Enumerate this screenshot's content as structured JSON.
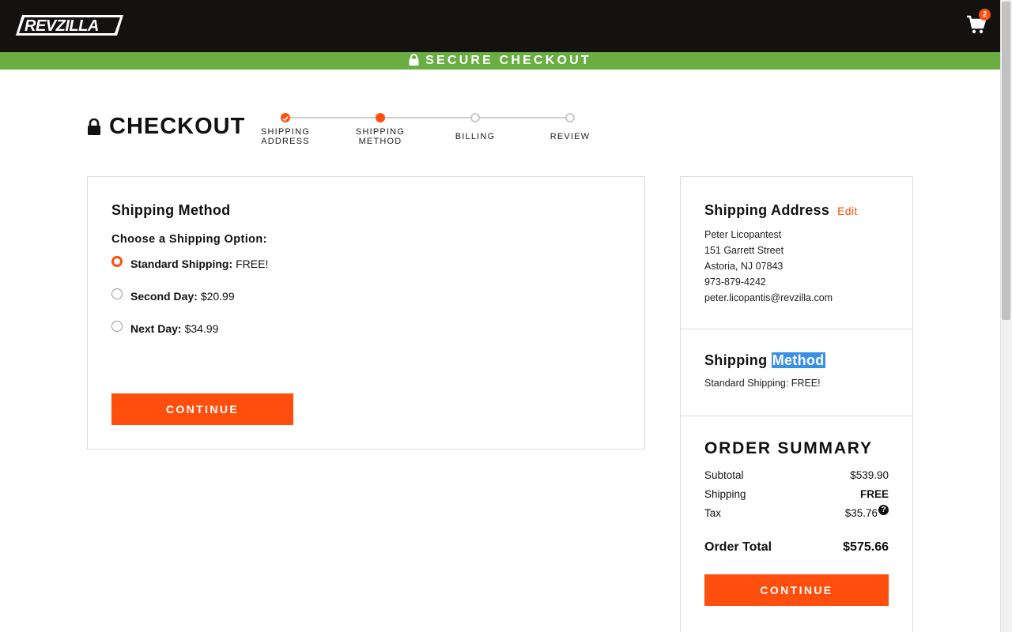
{
  "header": {
    "logo_text": "REVZILLA",
    "cart_count": "2"
  },
  "secure_bar": {
    "label": "SECURE CHECKOUT"
  },
  "checkout": {
    "title": "CHECKOUT",
    "steps": [
      {
        "line1": "SHIPPING",
        "line2": "ADDRESS",
        "state": "done"
      },
      {
        "line1": "SHIPPING",
        "line2": "METHOD",
        "state": "active"
      },
      {
        "line1": "BILLING",
        "line2": "",
        "state": "pending"
      },
      {
        "line1": "REVIEW",
        "line2": "",
        "state": "pending"
      }
    ]
  },
  "shipping_method": {
    "heading": "Shipping Method",
    "prompt": "Choose a Shipping Option:",
    "options": [
      {
        "name": "Standard Shipping:",
        "price": "FREE!",
        "selected": true
      },
      {
        "name": "Second Day:",
        "price": "$20.99",
        "selected": false
      },
      {
        "name": "Next Day:",
        "price": "$34.99",
        "selected": false
      }
    ],
    "continue_label": "CONTINUE"
  },
  "sidebar": {
    "address": {
      "heading": "Shipping Address",
      "edit_label": "Edit",
      "lines": [
        "Peter Licopantest",
        "151 Garrett Street",
        "Astoria, NJ 07843",
        "973-879-4242",
        "peter.licopantis@revzilla.com"
      ]
    },
    "method": {
      "heading_word1": "Shipping",
      "heading_word2": "Method",
      "value": "Standard Shipping: FREE!"
    },
    "summary": {
      "heading": "ORDER SUMMARY",
      "subtotal_label": "Subtotal",
      "subtotal_value": "$539.90",
      "shipping_label": "Shipping",
      "shipping_value": "FREE",
      "tax_label": "Tax",
      "tax_value": "$35.76",
      "tax_help": "?",
      "total_label": "Order Total",
      "total_value": "$575.66",
      "continue_label": "CONTINUE"
    }
  },
  "colors": {
    "accent": "#ff4e0e",
    "secure_green": "#6aad42",
    "header_black": "#141111"
  }
}
